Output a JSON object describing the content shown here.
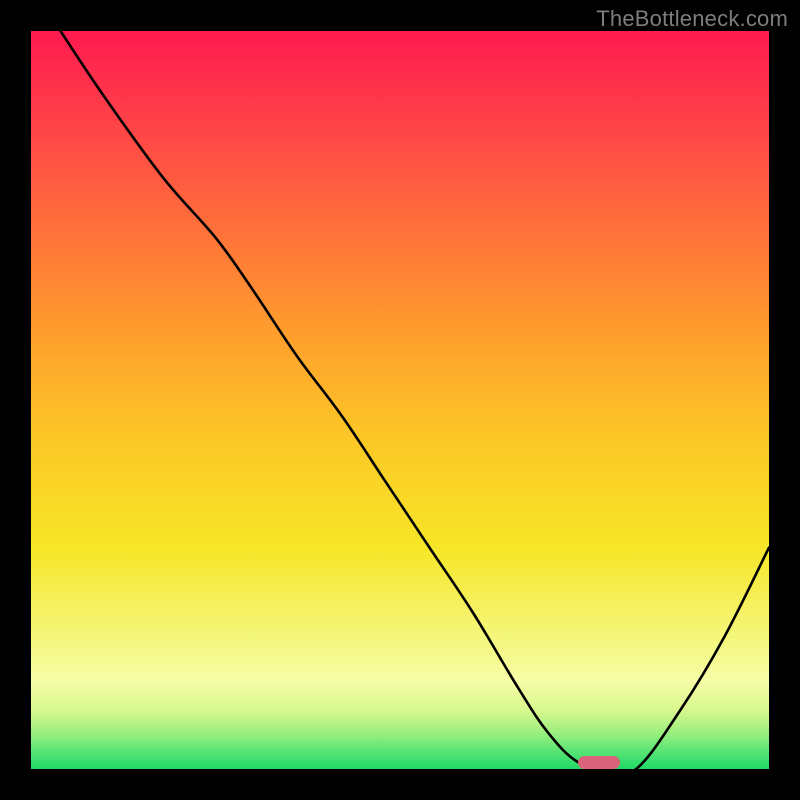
{
  "watermark": "TheBottleneck.com",
  "colors": {
    "frame": "#000000",
    "curve": "#000000",
    "marker": "#d9637a"
  },
  "chart_data": {
    "type": "line",
    "title": "",
    "xlabel": "",
    "ylabel": "",
    "xlim": [
      0,
      100
    ],
    "ylim": [
      0,
      100
    ],
    "grid": false,
    "series": [
      {
        "name": "bottleneck-curve",
        "x": [
          4,
          10,
          18,
          25,
          30,
          36,
          42,
          48,
          54,
          60,
          66,
          70,
          74,
          78,
          82,
          88,
          94,
          100
        ],
        "y": [
          100,
          91,
          80,
          72,
          65,
          56,
          48,
          39,
          30,
          21,
          11,
          5,
          1,
          0,
          0,
          8,
          18,
          30
        ]
      }
    ],
    "marker": {
      "x": 77,
      "y": 0,
      "width_pct": 5.7,
      "height_pct": 1.8
    },
    "gradient_stops": [
      {
        "pct": 0,
        "color": "#ff1a4f"
      },
      {
        "pct": 25,
        "color": "#ff6a3c"
      },
      {
        "pct": 55,
        "color": "#fcc726"
      },
      {
        "pct": 82,
        "color": "#f4f67a"
      },
      {
        "pct": 95,
        "color": "#9ef07e"
      },
      {
        "pct": 100,
        "color": "#1fd968"
      }
    ]
  }
}
